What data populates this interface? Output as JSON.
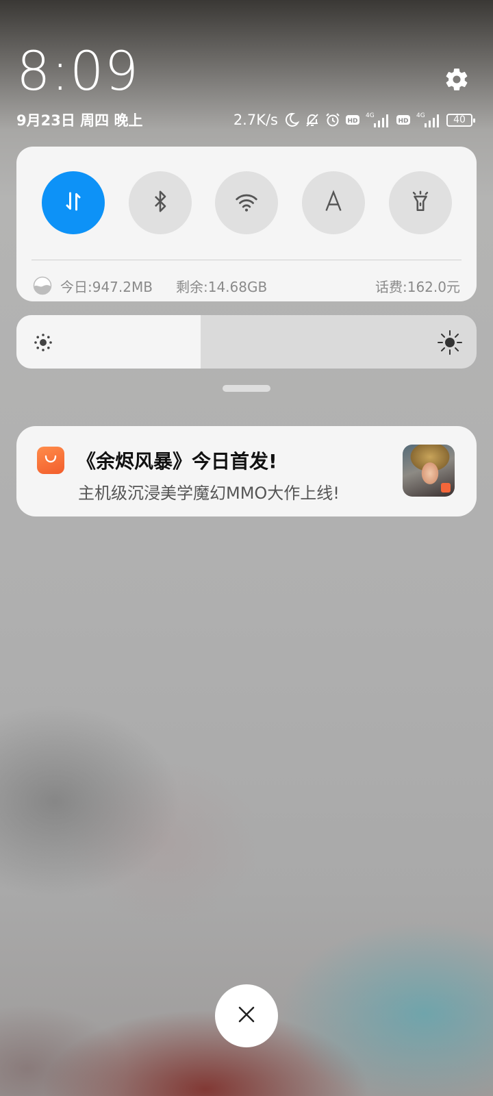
{
  "header": {
    "time": "8:09",
    "date": "9月23日 周四 晚上",
    "settings_icon": "gear-icon"
  },
  "status_bar": {
    "network_speed": "2.7K/s",
    "icons": [
      "moon-icon",
      "bell-off-icon",
      "alarm-clock-icon",
      "hd-badge-icon",
      "signal-4g-icon",
      "hd-badge-icon",
      "signal-4g-icon"
    ],
    "sim1": {
      "hd": "HD",
      "network": "4G"
    },
    "sim2": {
      "hd": "HD",
      "network": "4G"
    },
    "battery_level": "40"
  },
  "quick_settings": {
    "toggles": [
      {
        "name": "mobile-data",
        "icon": "data-arrows-icon",
        "active": true
      },
      {
        "name": "bluetooth",
        "icon": "bluetooth-icon",
        "active": false
      },
      {
        "name": "wifi",
        "icon": "wifi-icon",
        "active": false
      },
      {
        "name": "auto-brightness",
        "icon": "letter-a-icon",
        "active": false
      },
      {
        "name": "flashlight",
        "icon": "flashlight-icon",
        "active": false
      }
    ],
    "usage": {
      "today": "今日:947.2MB",
      "remaining": "剩余:14.68GB",
      "balance": "话费:162.0元"
    }
  },
  "brightness": {
    "level_fraction": 0.4
  },
  "notification": {
    "app_icon": "shopping-bag-icon",
    "title": "《余烬风暴》今日首发!",
    "body": "主机级沉浸美学魔幻MMO大作上线!"
  },
  "close_button": {
    "icon": "close-icon"
  },
  "colors": {
    "accent": "#0d92f7",
    "app_icon": "#f4663a",
    "panel_bg": "#f5f5f5"
  }
}
